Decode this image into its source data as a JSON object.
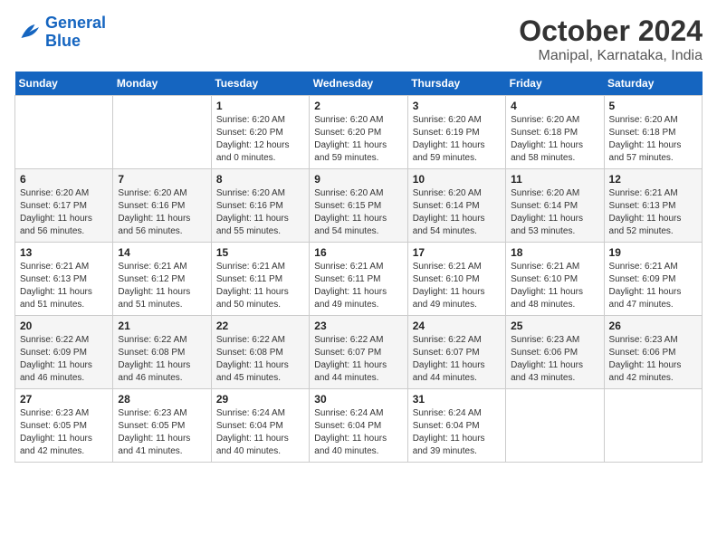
{
  "header": {
    "logo_line1": "General",
    "logo_line2": "Blue",
    "title": "October 2024",
    "subtitle": "Manipal, Karnataka, India"
  },
  "days_of_week": [
    "Sunday",
    "Monday",
    "Tuesday",
    "Wednesday",
    "Thursday",
    "Friday",
    "Saturday"
  ],
  "weeks": [
    [
      {
        "num": "",
        "sunrise": "",
        "sunset": "",
        "daylight": ""
      },
      {
        "num": "",
        "sunrise": "",
        "sunset": "",
        "daylight": ""
      },
      {
        "num": "1",
        "sunrise": "Sunrise: 6:20 AM",
        "sunset": "Sunset: 6:20 PM",
        "daylight": "Daylight: 12 hours and 0 minutes."
      },
      {
        "num": "2",
        "sunrise": "Sunrise: 6:20 AM",
        "sunset": "Sunset: 6:20 PM",
        "daylight": "Daylight: 11 hours and 59 minutes."
      },
      {
        "num": "3",
        "sunrise": "Sunrise: 6:20 AM",
        "sunset": "Sunset: 6:19 PM",
        "daylight": "Daylight: 11 hours and 59 minutes."
      },
      {
        "num": "4",
        "sunrise": "Sunrise: 6:20 AM",
        "sunset": "Sunset: 6:18 PM",
        "daylight": "Daylight: 11 hours and 58 minutes."
      },
      {
        "num": "5",
        "sunrise": "Sunrise: 6:20 AM",
        "sunset": "Sunset: 6:18 PM",
        "daylight": "Daylight: 11 hours and 57 minutes."
      }
    ],
    [
      {
        "num": "6",
        "sunrise": "Sunrise: 6:20 AM",
        "sunset": "Sunset: 6:17 PM",
        "daylight": "Daylight: 11 hours and 56 minutes."
      },
      {
        "num": "7",
        "sunrise": "Sunrise: 6:20 AM",
        "sunset": "Sunset: 6:16 PM",
        "daylight": "Daylight: 11 hours and 56 minutes."
      },
      {
        "num": "8",
        "sunrise": "Sunrise: 6:20 AM",
        "sunset": "Sunset: 6:16 PM",
        "daylight": "Daylight: 11 hours and 55 minutes."
      },
      {
        "num": "9",
        "sunrise": "Sunrise: 6:20 AM",
        "sunset": "Sunset: 6:15 PM",
        "daylight": "Daylight: 11 hours and 54 minutes."
      },
      {
        "num": "10",
        "sunrise": "Sunrise: 6:20 AM",
        "sunset": "Sunset: 6:14 PM",
        "daylight": "Daylight: 11 hours and 54 minutes."
      },
      {
        "num": "11",
        "sunrise": "Sunrise: 6:20 AM",
        "sunset": "Sunset: 6:14 PM",
        "daylight": "Daylight: 11 hours and 53 minutes."
      },
      {
        "num": "12",
        "sunrise": "Sunrise: 6:21 AM",
        "sunset": "Sunset: 6:13 PM",
        "daylight": "Daylight: 11 hours and 52 minutes."
      }
    ],
    [
      {
        "num": "13",
        "sunrise": "Sunrise: 6:21 AM",
        "sunset": "Sunset: 6:13 PM",
        "daylight": "Daylight: 11 hours and 51 minutes."
      },
      {
        "num": "14",
        "sunrise": "Sunrise: 6:21 AM",
        "sunset": "Sunset: 6:12 PM",
        "daylight": "Daylight: 11 hours and 51 minutes."
      },
      {
        "num": "15",
        "sunrise": "Sunrise: 6:21 AM",
        "sunset": "Sunset: 6:11 PM",
        "daylight": "Daylight: 11 hours and 50 minutes."
      },
      {
        "num": "16",
        "sunrise": "Sunrise: 6:21 AM",
        "sunset": "Sunset: 6:11 PM",
        "daylight": "Daylight: 11 hours and 49 minutes."
      },
      {
        "num": "17",
        "sunrise": "Sunrise: 6:21 AM",
        "sunset": "Sunset: 6:10 PM",
        "daylight": "Daylight: 11 hours and 49 minutes."
      },
      {
        "num": "18",
        "sunrise": "Sunrise: 6:21 AM",
        "sunset": "Sunset: 6:10 PM",
        "daylight": "Daylight: 11 hours and 48 minutes."
      },
      {
        "num": "19",
        "sunrise": "Sunrise: 6:21 AM",
        "sunset": "Sunset: 6:09 PM",
        "daylight": "Daylight: 11 hours and 47 minutes."
      }
    ],
    [
      {
        "num": "20",
        "sunrise": "Sunrise: 6:22 AM",
        "sunset": "Sunset: 6:09 PM",
        "daylight": "Daylight: 11 hours and 46 minutes."
      },
      {
        "num": "21",
        "sunrise": "Sunrise: 6:22 AM",
        "sunset": "Sunset: 6:08 PM",
        "daylight": "Daylight: 11 hours and 46 minutes."
      },
      {
        "num": "22",
        "sunrise": "Sunrise: 6:22 AM",
        "sunset": "Sunset: 6:08 PM",
        "daylight": "Daylight: 11 hours and 45 minutes."
      },
      {
        "num": "23",
        "sunrise": "Sunrise: 6:22 AM",
        "sunset": "Sunset: 6:07 PM",
        "daylight": "Daylight: 11 hours and 44 minutes."
      },
      {
        "num": "24",
        "sunrise": "Sunrise: 6:22 AM",
        "sunset": "Sunset: 6:07 PM",
        "daylight": "Daylight: 11 hours and 44 minutes."
      },
      {
        "num": "25",
        "sunrise": "Sunrise: 6:23 AM",
        "sunset": "Sunset: 6:06 PM",
        "daylight": "Daylight: 11 hours and 43 minutes."
      },
      {
        "num": "26",
        "sunrise": "Sunrise: 6:23 AM",
        "sunset": "Sunset: 6:06 PM",
        "daylight": "Daylight: 11 hours and 42 minutes."
      }
    ],
    [
      {
        "num": "27",
        "sunrise": "Sunrise: 6:23 AM",
        "sunset": "Sunset: 6:05 PM",
        "daylight": "Daylight: 11 hours and 42 minutes."
      },
      {
        "num": "28",
        "sunrise": "Sunrise: 6:23 AM",
        "sunset": "Sunset: 6:05 PM",
        "daylight": "Daylight: 11 hours and 41 minutes."
      },
      {
        "num": "29",
        "sunrise": "Sunrise: 6:24 AM",
        "sunset": "Sunset: 6:04 PM",
        "daylight": "Daylight: 11 hours and 40 minutes."
      },
      {
        "num": "30",
        "sunrise": "Sunrise: 6:24 AM",
        "sunset": "Sunset: 6:04 PM",
        "daylight": "Daylight: 11 hours and 40 minutes."
      },
      {
        "num": "31",
        "sunrise": "Sunrise: 6:24 AM",
        "sunset": "Sunset: 6:04 PM",
        "daylight": "Daylight: 11 hours and 39 minutes."
      },
      {
        "num": "",
        "sunrise": "",
        "sunset": "",
        "daylight": ""
      },
      {
        "num": "",
        "sunrise": "",
        "sunset": "",
        "daylight": ""
      }
    ]
  ]
}
